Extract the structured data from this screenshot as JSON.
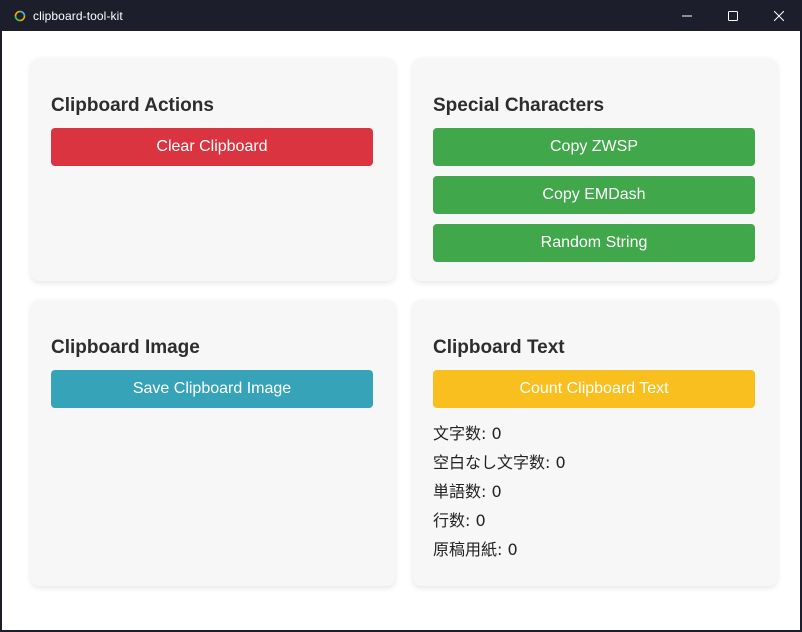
{
  "window": {
    "title": "clipboard-tool-kit",
    "minimize_icon": "minimize-icon",
    "maximize_icon": "maximize-icon",
    "close_icon": "close-icon"
  },
  "clipboard_actions": {
    "heading": "Clipboard Actions",
    "clear_label": "Clear Clipboard"
  },
  "special_characters": {
    "heading": "Special Characters",
    "copy_zwsp_label": "Copy ZWSP",
    "copy_emdash_label": "Copy EMDash",
    "random_string_label": "Random String"
  },
  "clipboard_image": {
    "heading": "Clipboard Image",
    "save_label": "Save Clipboard Image"
  },
  "clipboard_text": {
    "heading": "Clipboard Text",
    "count_label": "Count Clipboard Text",
    "stats": [
      {
        "label": "文字数",
        "value": "0"
      },
      {
        "label": "空白なし文字数",
        "value": "0"
      },
      {
        "label": "単語数",
        "value": "0"
      },
      {
        "label": "行数",
        "value": "0"
      },
      {
        "label": "原稿用紙",
        "value": "0"
      }
    ]
  },
  "colors": {
    "red": "#d9343f",
    "green": "#40a84a",
    "teal": "#37a3b9",
    "yellow": "#f8bf1f",
    "titlebar": "#1c1f2b"
  }
}
